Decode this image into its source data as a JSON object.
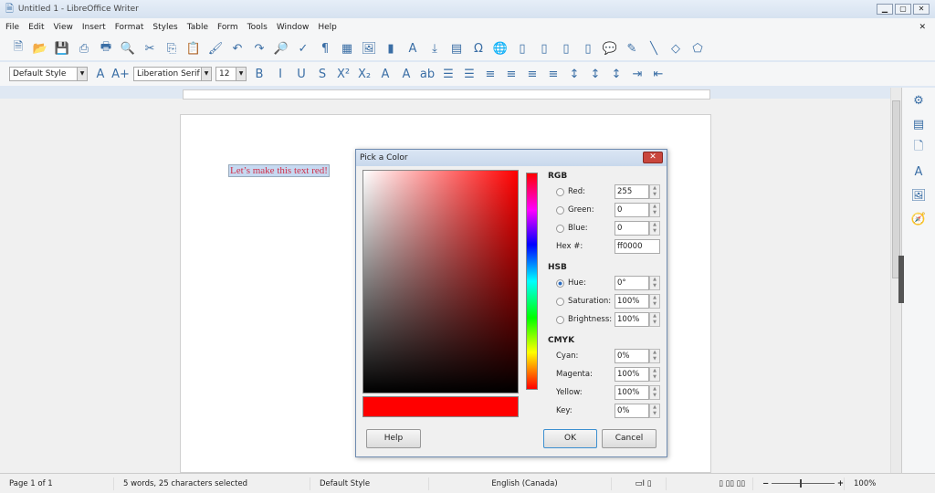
{
  "window": {
    "title": "Untitled 1 - LibreOffice Writer"
  },
  "menu": [
    "File",
    "Edit",
    "View",
    "Insert",
    "Format",
    "Styles",
    "Table",
    "Form",
    "Tools",
    "Window",
    "Help"
  ],
  "toolbar1": [
    [
      "new-document",
      "🗎"
    ],
    [
      "open",
      "📂"
    ],
    [
      "save",
      "💾"
    ],
    [
      "export-pdf",
      "⎙"
    ],
    [
      "print",
      "🖶"
    ],
    [
      "print-preview",
      "🔍"
    ],
    [
      "cut",
      "✂"
    ],
    [
      "copy",
      "⎘"
    ],
    [
      "paste",
      "📋"
    ],
    [
      "clone-formatting",
      "🖌"
    ],
    [
      "undo",
      "↶"
    ],
    [
      "redo",
      "↷"
    ],
    [
      "find-replace",
      "🔎"
    ],
    [
      "spellcheck",
      "✓"
    ],
    [
      "formatting-marks",
      "¶"
    ],
    [
      "insert-table",
      "▦"
    ],
    [
      "insert-image",
      "🖼"
    ],
    [
      "insert-chart",
      "▮"
    ],
    [
      "insert-textbox",
      "A"
    ],
    [
      "page-break",
      "⤓"
    ],
    [
      "insert-field",
      "▤"
    ],
    [
      "special-character",
      "Ω"
    ],
    [
      "hyperlink",
      "🌐"
    ],
    [
      "footnote",
      "▯"
    ],
    [
      "endnote",
      "▯"
    ],
    [
      "bookmark",
      "▯"
    ],
    [
      "cross-reference",
      "▯"
    ],
    [
      "comment",
      "💬"
    ],
    [
      "track-changes",
      "✎"
    ],
    [
      "line",
      "╲"
    ],
    [
      "basic-shapes",
      "◇"
    ],
    [
      "draw-functions",
      "⬠"
    ]
  ],
  "toolbar2": {
    "paragraph_style": "Default Style",
    "font_name": "Liberation Serif",
    "font_size": "12",
    "icons": [
      [
        "update-style",
        "A"
      ],
      [
        "new-style",
        "A+"
      ],
      [
        "bold",
        "B"
      ],
      [
        "italic",
        "I"
      ],
      [
        "underline",
        "U"
      ],
      [
        "strikethrough",
        "S"
      ],
      [
        "superscript",
        "X²"
      ],
      [
        "subscript",
        "X₂"
      ],
      [
        "clear-formatting",
        "A"
      ],
      [
        "font-color",
        "A"
      ],
      [
        "highlight",
        "ab"
      ],
      [
        "bullets",
        "☰"
      ],
      [
        "numbering",
        "☰"
      ],
      [
        "align-left",
        "≡"
      ],
      [
        "align-center",
        "≡"
      ],
      [
        "align-right",
        "≡"
      ],
      [
        "justify",
        "≡"
      ],
      [
        "line-spacing",
        "↕"
      ],
      [
        "paragraph-spacing",
        "↕"
      ],
      [
        "spacing-decrease",
        "↕"
      ],
      [
        "indent-increase",
        "⇥"
      ],
      [
        "indent-decrease",
        "⇤"
      ]
    ]
  },
  "document": {
    "selected_text": "Let’s make this text red!"
  },
  "sidebar": [
    [
      "properties",
      "⚙"
    ],
    [
      "styles",
      "▤"
    ],
    [
      "page",
      "🗋"
    ],
    [
      "styles-fonts",
      "A"
    ],
    [
      "gallery",
      "🖼"
    ],
    [
      "navigator",
      "🧭"
    ]
  ],
  "dialog": {
    "title": "Pick a Color",
    "close": "✕",
    "selected_color": "#ff0000",
    "rgb": {
      "heading": "RGB",
      "red_label": "Red:",
      "red": "255",
      "green_label": "Green:",
      "green": "0",
      "blue_label": "Blue:",
      "blue": "0",
      "hex_label": "Hex #:",
      "hex": "ff0000"
    },
    "hsb": {
      "heading": "HSB",
      "hue_label": "Hue:",
      "hue": "0°",
      "sat_label": "Saturation:",
      "sat": "100%",
      "bri_label": "Brightness:",
      "bri": "100%",
      "selected": "hue"
    },
    "cmyk": {
      "heading": "CMYK",
      "cyan_label": "Cyan:",
      "cyan": "0%",
      "magenta_label": "Magenta:",
      "magenta": "100%",
      "yellow_label": "Yellow:",
      "yellow": "100%",
      "key_label": "Key:",
      "key": "0%"
    },
    "help": "Help",
    "ok": "OK",
    "cancel": "Cancel"
  },
  "status": {
    "page": "Page 1 of 1",
    "words": "5 words, 25 characters selected",
    "style": "Default Style",
    "language": "English (Canada)",
    "zoom": "100%",
    "zoom_minus": "−",
    "zoom_plus": "+"
  }
}
